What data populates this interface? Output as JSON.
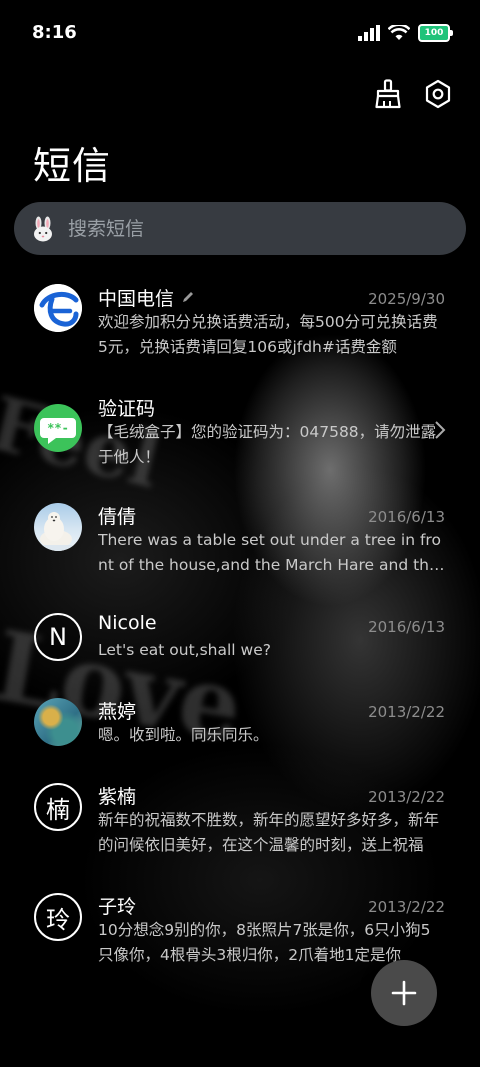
{
  "status_bar": {
    "time": "8:16",
    "battery": "100"
  },
  "page": {
    "title": "短信"
  },
  "search": {
    "placeholder": "搜索短信"
  },
  "background": {
    "words": [
      "Feel",
      "Love"
    ]
  },
  "conversations": [
    {
      "name": "中国电信",
      "date": "2025/9/30",
      "snippet": "欢迎参加积分兑换话费活动，每500分可兑换话费5元，兑换话费请回复106或jfdh#话费金额",
      "avatar": "china-telecom-logo"
    },
    {
      "name": "验证码",
      "date": "",
      "snippet": "【毛绒盒子】您的验证码为：047588，请勿泄露于他人！",
      "avatar": "verification-code-icon"
    },
    {
      "name": "倩倩",
      "date": "2016/6/13",
      "snippet": "There was a table set out under a tree in front of the house,and the March Hare and the Hatter",
      "avatar": "polar-bear-photo"
    },
    {
      "name": "Nicole",
      "date": "2016/6/13",
      "snippet": "Let's eat out,shall we?",
      "avatar": "N"
    },
    {
      "name": "燕婷",
      "date": "2013/2/22",
      "snippet": "嗯。收到啦。同乐同乐。",
      "avatar": "landscape-photo"
    },
    {
      "name": "紫楠",
      "date": "2013/2/22",
      "snippet": "新年的祝福数不胜数，新年的愿望好多好多，新年的问候依旧美好，在这个温馨的时刻，送上祝福",
      "avatar": "楠"
    },
    {
      "name": "子玲",
      "date": "2013/2/22",
      "snippet": "10分想念9别的你，8张照片7张是你，6只小狗5只像你，4根骨头3根归你，2爪着地1定是你",
      "avatar": "玲"
    }
  ],
  "colors": {
    "accent_green": "#3cc35a",
    "telecom_blue": "#1a63d6",
    "battery_green": "#1fc37a"
  }
}
